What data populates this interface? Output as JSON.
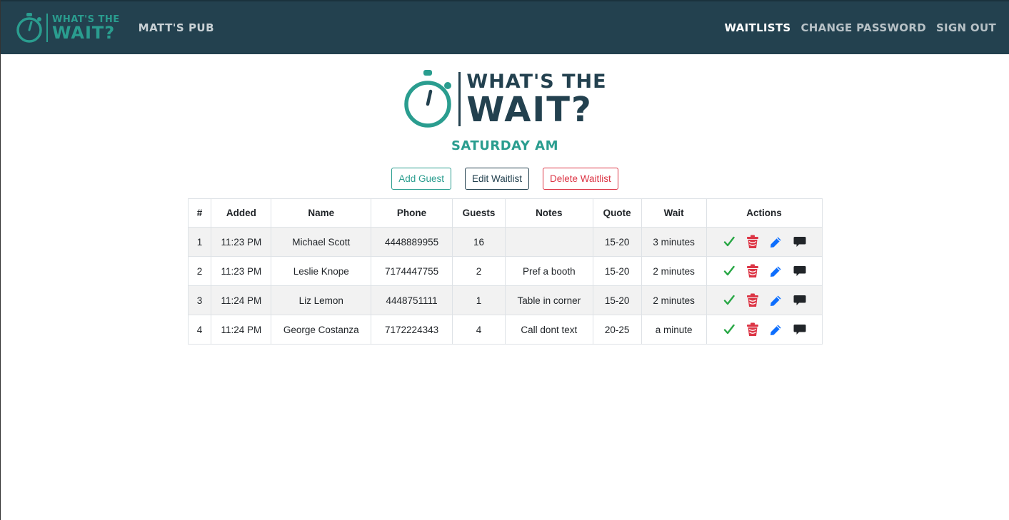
{
  "nav": {
    "logo_top": "WHAT'S THE",
    "logo_bottom": "WAIT?",
    "brand": "MATT'S PUB",
    "links": [
      "WAITLISTS",
      "CHANGE PASSWORD",
      "SIGN OUT"
    ]
  },
  "hero": {
    "logo_top": "WHAT'S THE",
    "logo_bottom": "WAIT?",
    "title": "SATURDAY AM"
  },
  "buttons": {
    "add": "Add Guest",
    "edit": "Edit Waitlist",
    "delete": "Delete Waitlist"
  },
  "table": {
    "headers": [
      "#",
      "Added",
      "Name",
      "Phone",
      "Guests",
      "Notes",
      "Quote",
      "Wait",
      "Actions"
    ],
    "rows": [
      [
        "1",
        "11:23 PM",
        "Michael Scott",
        "4448889955",
        "16",
        "",
        "15-20",
        "3 minutes"
      ],
      [
        "2",
        "11:23 PM",
        "Leslie Knope",
        "7174447755",
        "2",
        "Pref a booth",
        "15-20",
        "2 minutes"
      ],
      [
        "3",
        "11:24 PM",
        "Liz Lemon",
        "4448751111",
        "1",
        "Table in corner",
        "15-20",
        "2 minutes"
      ],
      [
        "4",
        "11:24 PM",
        "George Costanza",
        "7172224343",
        "4",
        "Call dont text",
        "20-25",
        "a minute"
      ]
    ]
  },
  "icons": {
    "check": "check-icon",
    "trash": "trash-icon",
    "pencil": "pencil-icon",
    "message": "message-icon"
  },
  "colors": {
    "navbar": "#23414f",
    "accent": "#2a9d8f",
    "danger": "#dc3545",
    "success": "#28a745",
    "primary": "#0d6efd"
  }
}
